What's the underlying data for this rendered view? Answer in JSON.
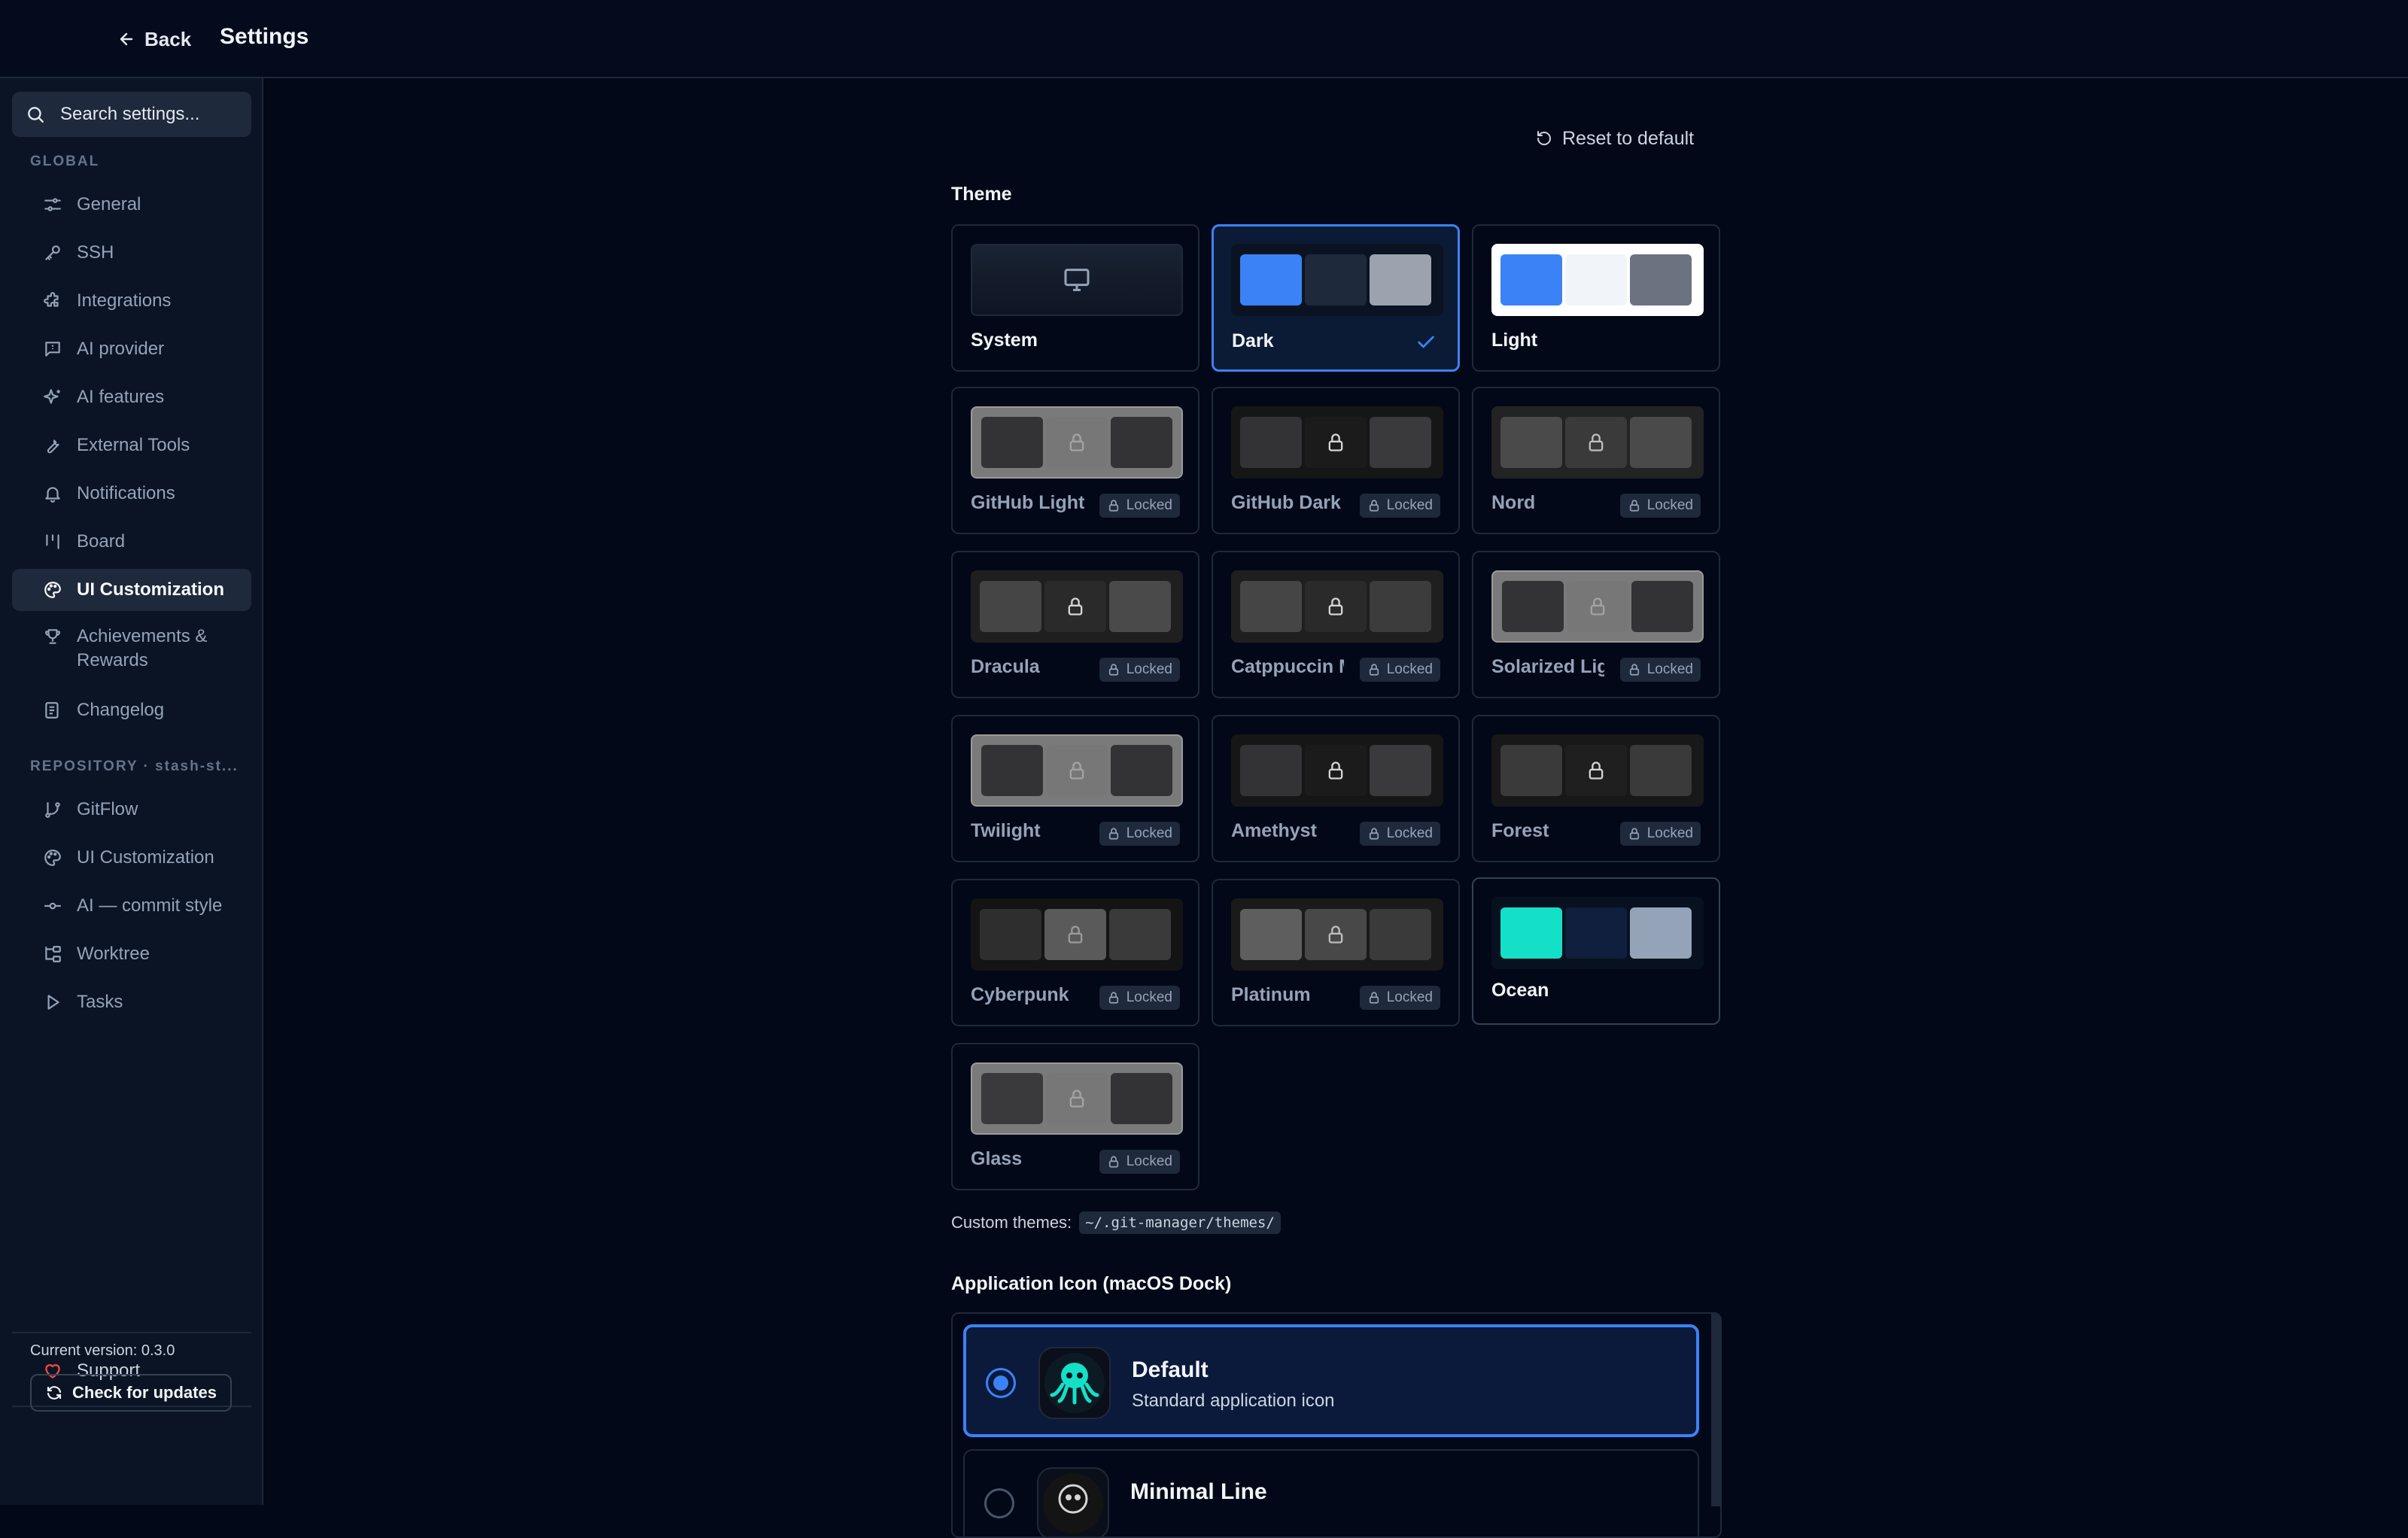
{
  "topbar": {
    "back_label": "Back",
    "title": "Settings"
  },
  "sidebar": {
    "search_placeholder": "Search settings...",
    "global_label": "GLOBAL",
    "global_items": [
      {
        "label": "General",
        "icon": "sliders-icon"
      },
      {
        "label": "SSH",
        "icon": "key-icon"
      },
      {
        "label": "Integrations",
        "icon": "puzzle-icon"
      },
      {
        "label": "AI provider",
        "icon": "message-square-icon"
      },
      {
        "label": "AI features",
        "icon": "sparkles-icon"
      },
      {
        "label": "External Tools",
        "icon": "wrench-icon"
      },
      {
        "label": "Notifications",
        "icon": "bell-icon"
      },
      {
        "label": "Board",
        "icon": "kanban-icon"
      },
      {
        "label": "UI Customization",
        "icon": "palette-icon",
        "active": true
      },
      {
        "label": "Achievements & Rewards",
        "icon": "trophy-icon"
      },
      {
        "label": "Changelog",
        "icon": "list-icon"
      }
    ],
    "repository_label": "REPOSITORY · stash-st...",
    "repo_items": [
      {
        "label": "GitFlow",
        "icon": "git-branch-icon"
      },
      {
        "label": "UI Customization",
        "icon": "palette-icon"
      },
      {
        "label": "AI — commit style",
        "icon": "git-commit-icon"
      },
      {
        "label": "Worktree",
        "icon": "folder-tree-icon"
      },
      {
        "label": "Tasks",
        "icon": "play-icon"
      }
    ],
    "support_label": "Support",
    "version_text": "Current version: 0.3.0",
    "check_updates_label": "Check for updates"
  },
  "main": {
    "reset_label": "Reset to default",
    "theme_heading": "Theme",
    "locked_label": "Locked",
    "themes": [
      {
        "name": "System",
        "locked": false,
        "selected": false
      },
      {
        "name": "Dark",
        "locked": false,
        "selected": true
      },
      {
        "name": "Light",
        "locked": false,
        "selected": false
      },
      {
        "name": "GitHub Light",
        "locked": true
      },
      {
        "name": "GitHub Dark",
        "locked": true
      },
      {
        "name": "Nord",
        "locked": true
      },
      {
        "name": "Dracula",
        "locked": true
      },
      {
        "name": "Catppuccin M",
        "locked": true
      },
      {
        "name": "Solarized Lig",
        "locked": true
      },
      {
        "name": "Twilight",
        "locked": true
      },
      {
        "name": "Amethyst",
        "locked": true
      },
      {
        "name": "Forest",
        "locked": true
      },
      {
        "name": "Cyberpunk",
        "locked": true
      },
      {
        "name": "Platinum",
        "locked": true
      },
      {
        "name": "Ocean",
        "locked": false,
        "selected": false
      },
      {
        "name": "Glass",
        "locked": true
      }
    ],
    "custom_themes_label": "Custom themes:",
    "custom_themes_path": "~/.git-manager/themes/",
    "app_icon_heading": "Application Icon (macOS Dock)",
    "app_icons": [
      {
        "title": "Default",
        "description": "Standard application icon",
        "selected": true
      },
      {
        "title": "Minimal Line",
        "description": "",
        "selected": false
      }
    ]
  },
  "colors": {
    "accent": "#3b82f6",
    "background": "#020817",
    "ocean_teal": "#14e0c8",
    "support_heart": "#ef4444"
  }
}
